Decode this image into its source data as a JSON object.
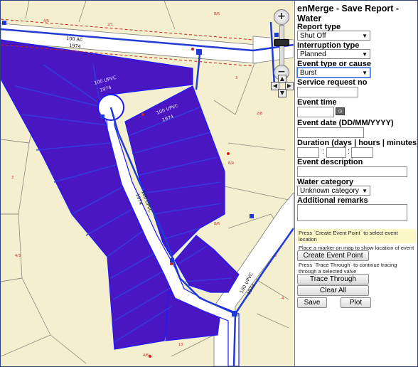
{
  "panel": {
    "title": "enMerge - Save Report - Water",
    "report_type": {
      "label": "Report type",
      "value": "Shut Off"
    },
    "interruption_type": {
      "label": "Interruption type",
      "value": "Planned"
    },
    "event_type": {
      "label": "Event type or cause",
      "value": "Burst"
    },
    "service_request": {
      "label": "Service request no",
      "value": ""
    },
    "event_time": {
      "label": "Event time",
      "value": ""
    },
    "event_date": {
      "label": "Event date (DD/MM/YYYY)",
      "value": ""
    },
    "duration": {
      "label": "Duration (days | hours | minutes)",
      "days": "",
      "hours": "",
      "minutes": ""
    },
    "event_description": {
      "label": "Event description",
      "value": ""
    },
    "water_category": {
      "label": "Water category",
      "value": "Unknown category"
    },
    "additional_remarks": {
      "label": "Additional remarks",
      "value": ""
    },
    "note_create": "Press `Create Event Point` to select event location",
    "note_marker": "Place a marker on map to show location of event",
    "create_button": "Create Event Point",
    "note_trace": "Press `Trace Through` to continue tracing through a selected valve",
    "trace_button": "Trace Through",
    "clear_button": "Clear All",
    "save_button": "Save",
    "plot_button": "Plot"
  },
  "map": {
    "zoom_in": "+",
    "zoom_out": "−",
    "pipe_labels": {
      "top_main": "100 AC",
      "top_main_year": "1974",
      "cul_de_sac": "100 UPVC",
      "cul_de_sac_year": "1974",
      "branch": "100 UPVC",
      "branch_year": "1974",
      "vertical": "100 UPVC",
      "vertical_year": "1974",
      "right_lower": "100 UPVC",
      "right_lower_year": "1974"
    },
    "colors": {
      "background": "#f4f0cf",
      "shutoff_area": "#4a16c2",
      "pipe": "#1f3ad6",
      "road": "#ffffff",
      "property_line": "#cc2222"
    }
  }
}
